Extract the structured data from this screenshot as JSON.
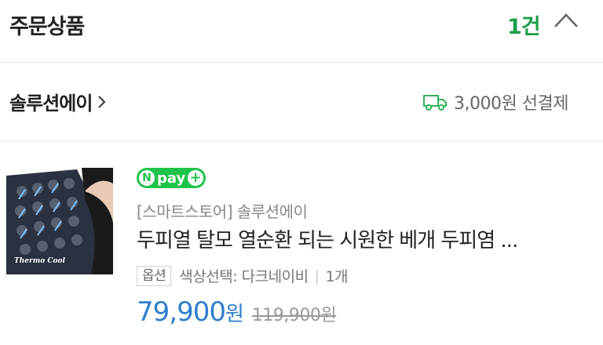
{
  "header": {
    "title": "주문상품",
    "count": "1건",
    "collapse_icon": "chevron-up-icon"
  },
  "seller": {
    "name": "솔루션에이",
    "shipping_icon": "truck-icon",
    "shipping_text": "3,000원 선결제"
  },
  "product": {
    "thumbnail_label": "Thermo Cool",
    "badge_text": "pay",
    "badge_letter": "N",
    "store": "[스마트스토어] 솔루션에이",
    "title": "두피열 탈모 열순환 되는 시원한 베개 두피염 ...",
    "option_label": "옵션",
    "option_value": "색상선택: 다크네이비",
    "quantity": "1개",
    "price": "79,900",
    "price_unit": "원",
    "original_price": "119,900원"
  },
  "colors": {
    "accent_green": "#1e9e4a",
    "price_blue": "#2e7ecf",
    "npay_green": "#1fc34a"
  }
}
